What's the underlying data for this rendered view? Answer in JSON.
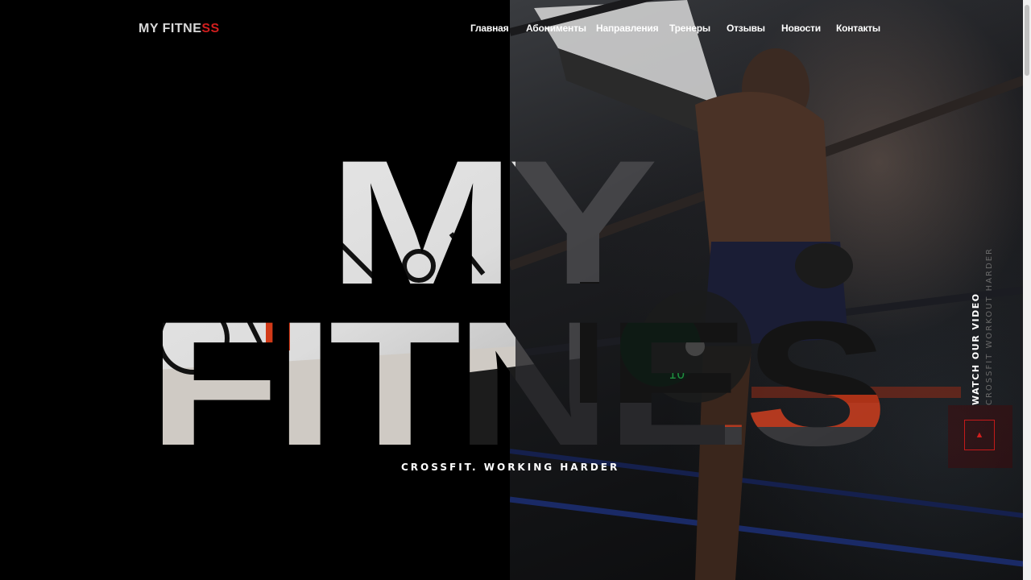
{
  "header": {
    "logo_main": "MY FITNE",
    "logo_accent": "SS",
    "nav": [
      "Главная",
      "Абонименты",
      "Направления",
      "Тренеры",
      "Отзывы",
      "Новости",
      "Контакты"
    ]
  },
  "hero": {
    "line1": "MY",
    "line2": "FITNES",
    "tagline": "CROSSFIT. WORKING HARDER"
  },
  "side": {
    "video_label": "WATCH OUR VIDEO",
    "video_sub": "CROSSFIT WORKOUT HARDER"
  },
  "colors": {
    "accent": "#d21e1e",
    "background": "#000000",
    "text": "#ffffff"
  },
  "icons": {
    "scroll_top": "arrow-up-icon"
  }
}
